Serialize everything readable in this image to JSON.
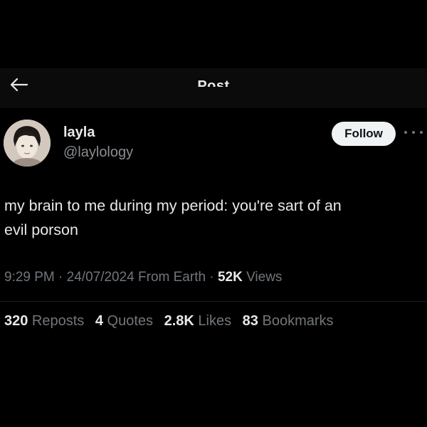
{
  "header": {
    "title": "Post",
    "back_icon": "arrow-left-icon"
  },
  "author": {
    "display_name": "layla",
    "handle": "@laylology",
    "follow_label": "Follow",
    "more_icon": "more-horizontal-icon"
  },
  "tweet": {
    "line1": "my brain to me during my period: you're sart of an",
    "line2": "evil porson"
  },
  "meta": {
    "time": "9:29 PM",
    "sep1": " · ",
    "date": "24/07/2024",
    "source": " From Earth",
    "sep2": " · ",
    "views_count": "52K",
    "views_label": " Views"
  },
  "stats": [
    {
      "count": "320",
      "label": " Reposts"
    },
    {
      "count": "4",
      "label": " Quotes"
    },
    {
      "count": "2.8K",
      "label": " Likes"
    },
    {
      "count": "83",
      "label": " Bookmarks"
    }
  ],
  "colors": {
    "background": "#000000",
    "text_primary": "#e7e9ea",
    "text_secondary": "#71767b",
    "follow_bg": "#eff3f4"
  }
}
